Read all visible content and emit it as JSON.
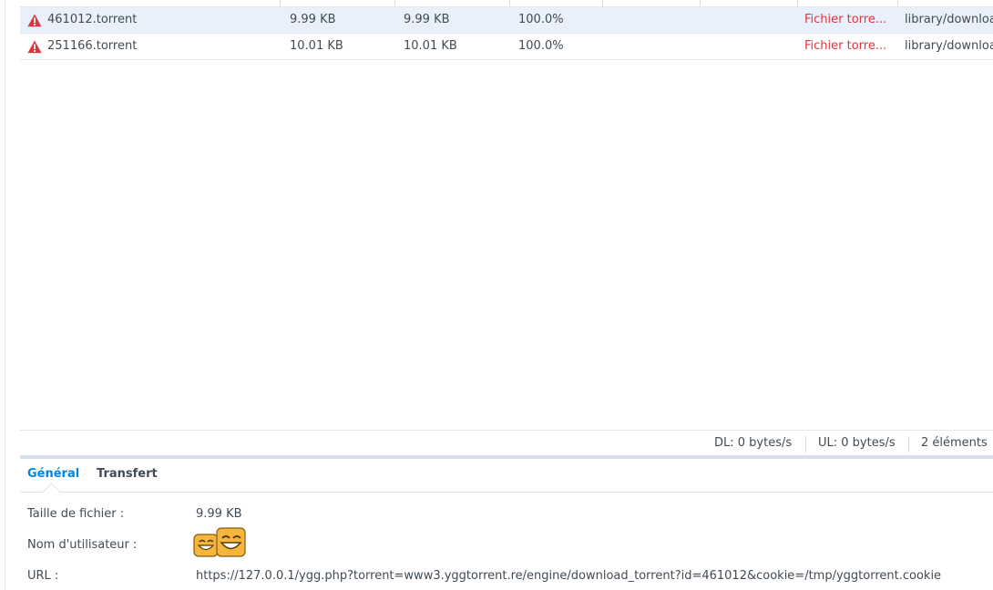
{
  "torrent_list": {
    "rows": [
      {
        "name": "461012.torrent",
        "size": "9.99 KB",
        "downloaded": "9.99 KB",
        "progress": "100.0%",
        "status": "Fichier torre...",
        "destination": "library/downloa",
        "selected": true,
        "status_icon": "warning-icon"
      },
      {
        "name": "251166.torrent",
        "size": "10.01 KB",
        "downloaded": "10.01 KB",
        "progress": "100.0%",
        "status": "Fichier torre...",
        "destination": "library/downloa",
        "selected": false,
        "status_icon": "warning-icon"
      }
    ]
  },
  "status_bar": {
    "dl": "DL: 0 bytes/s",
    "ul": "UL: 0 bytes/s",
    "count": "2 éléments"
  },
  "detail_tabs": {
    "general": "Général",
    "transfer": "Transfert",
    "active": "general"
  },
  "details": {
    "file_size_label": "Taille de fichier :",
    "file_size_value": "9.99 KB",
    "username_label": "Nom d'utilisateur :",
    "username_icon": "grinning-face-icon",
    "url_label": "URL :",
    "url_value": "https://127.0.0.1/ygg.php?torrent=www3.yggtorrent.re/engine/download_torrent?id=461012&cookie=/tmp/yggtorrent.cookie"
  },
  "colors": {
    "accent": "#0086e5",
    "error": "#e0343f",
    "selected_row": "#e8f1fb",
    "text": "#414b55"
  }
}
